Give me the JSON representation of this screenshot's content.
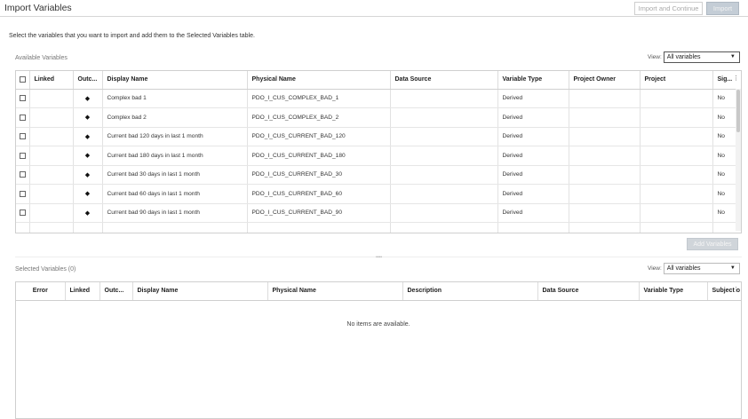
{
  "window": {
    "title": "Import Variables",
    "import_continue_label": "Import and Continue",
    "import_label": "Import"
  },
  "instructions": "Select the variables that you want to import and add them to the Selected Variables table.",
  "available": {
    "label": "Available Variables",
    "view_label": "View:",
    "view_value": "All variables",
    "columns": [
      "",
      "Linked",
      "Outc...",
      "Display Name",
      "Physical Name",
      "Data Source",
      "Variable Type",
      "Project Owner",
      "Project",
      "Sig..."
    ],
    "rows": [
      {
        "display_name": "Complex bad 1",
        "physical_name": "PDO_I_CUS_COMPLEX_BAD_1",
        "data_source": "",
        "variable_type": "Derived",
        "project_owner": "",
        "project": "",
        "sig": "No"
      },
      {
        "display_name": "Complex bad 2",
        "physical_name": "PDO_I_CUS_COMPLEX_BAD_2",
        "data_source": "",
        "variable_type": "Derived",
        "project_owner": "",
        "project": "",
        "sig": "No"
      },
      {
        "display_name": "Current bad 120 days in last 1 month",
        "physical_name": "PDO_I_CUS_CURRENT_BAD_120",
        "data_source": "",
        "variable_type": "Derived",
        "project_owner": "",
        "project": "",
        "sig": "No"
      },
      {
        "display_name": "Current bad 180 days in last 1 month",
        "physical_name": "PDO_I_CUS_CURRENT_BAD_180",
        "data_source": "",
        "variable_type": "Derived",
        "project_owner": "",
        "project": "",
        "sig": "No"
      },
      {
        "display_name": "Current bad 30 days in last 1 month",
        "physical_name": "PDO_I_CUS_CURRENT_BAD_30",
        "data_source": "",
        "variable_type": "Derived",
        "project_owner": "",
        "project": "",
        "sig": "No"
      },
      {
        "display_name": "Current bad 60 days in last 1 month",
        "physical_name": "PDO_I_CUS_CURRENT_BAD_60",
        "data_source": "",
        "variable_type": "Derived",
        "project_owner": "",
        "project": "",
        "sig": "No"
      },
      {
        "display_name": "Current bad 90 days in last 1 month",
        "physical_name": "PDO_I_CUS_CURRENT_BAD_90",
        "data_source": "",
        "variable_type": "Derived",
        "project_owner": "",
        "project": "",
        "sig": "No"
      }
    ],
    "outcome_glyph": "◆",
    "add_button_label": "Add Variables"
  },
  "selected": {
    "label": "Selected Variables (0)",
    "view_label": "View:",
    "view_value": "All variables",
    "columns": [
      "Error",
      "Linked",
      "Outc...",
      "Display Name",
      "Physical Name",
      "Description",
      "Data Source",
      "Variable Type",
      "Subject o"
    ],
    "empty_message": "No items are available."
  },
  "icons": {
    "dropdown": "chevron-down-icon",
    "column_menu": "column-menu-icon",
    "outcome": "diamond-icon"
  }
}
